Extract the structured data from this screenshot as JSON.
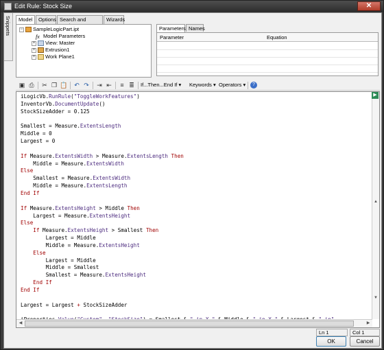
{
  "window": {
    "title": "Edit Rule: Stock Size",
    "close_label": "✕"
  },
  "side_tab": "Snippets",
  "tabs": [
    "Model",
    "Options",
    "Search and Replace",
    "Wizards"
  ],
  "tree": {
    "items": [
      "SampleLogicPart.ipt",
      "Model Parameters",
      "View: Master",
      "Extrusion1",
      "Work Plane1"
    ]
  },
  "param_tabs": [
    "Parameters",
    "Names"
  ],
  "param_grid": {
    "col_parameter": "Parameter",
    "col_equation": "Equation"
  },
  "toolbar": {
    "ifthen_label": "If...Then...End If",
    "keywords_label": "Keywords",
    "operators_label": "Operators"
  },
  "code_lines": [
    "iLogicVb.RunRule(\"ToggleWorkFeatures\")",
    "InventorVb.DocumentUpdate()",
    "StockSizeAdder = 0.125",
    "",
    "Smallest = Measure.ExtentsLength",
    "Middle = 0",
    "Largest = 0",
    "",
    "If Measure.ExtentsWidth > Measure.ExtentsLength Then",
    "    Middle = Measure.ExtentsWidth",
    "Else",
    "    Smallest = Measure.ExtentsWidth",
    "    Middle = Measure.ExtentsLength",
    "End If",
    "",
    "If Measure.ExtentsHeight > Middle Then",
    "    Largest = Measure.ExtentsHeight",
    "Else",
    "    If Measure.ExtentsHeight > Smallest Then",
    "        Largest = Middle",
    "        Middle = Measure.ExtentsHeight",
    "    Else",
    "        Largest = Middle",
    "        Middle = Smallest",
    "        Smallest = Measure.ExtentsHeight",
    "    End If",
    "End If",
    "",
    "Largest = Largest + StockSizeAdder",
    "",
    "iProperties.Value(\"Custom\", \"StockSize\") = Smallest & \" in X \" & Middle & \" in X \" & Largest & \" in\""
  ],
  "status": {
    "line": "Ln 1",
    "col": "Col 1"
  },
  "buttons": {
    "ok": "OK",
    "cancel": "Cancel"
  },
  "colors": {
    "keyword": "#a00000",
    "member": "#4b2a7e"
  }
}
